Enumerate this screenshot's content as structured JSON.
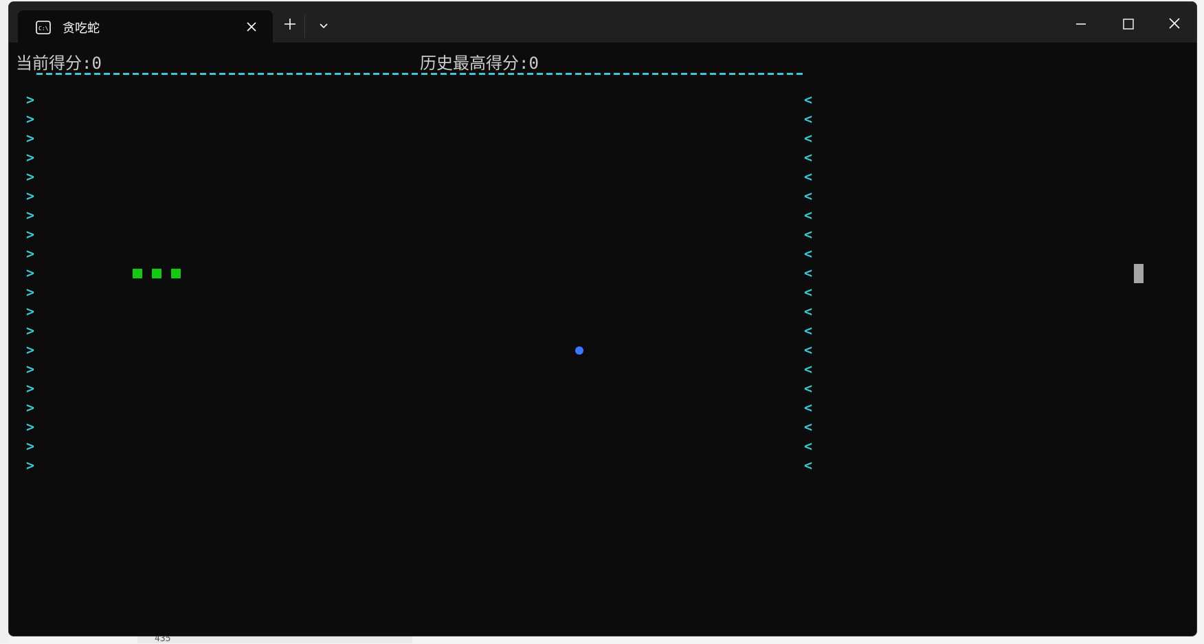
{
  "window": {
    "tab_title": "贪吃蛇",
    "tab_icon": "console-icon",
    "accent_color": "#3ec7d3"
  },
  "game": {
    "current_score_label": "当前得分:0",
    "high_score_label": "历史最高得分:0",
    "left_wall_char": ">",
    "right_wall_char": "<",
    "wall_rows": 20,
    "snake_color": "#14c814",
    "food_color": "#3b78ff",
    "snake_segments": 3
  },
  "background": {
    "gutter_text": "435"
  }
}
